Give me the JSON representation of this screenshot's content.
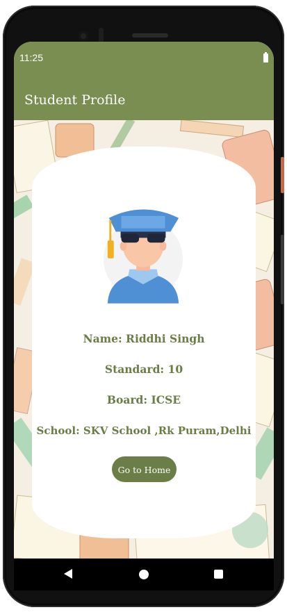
{
  "status_bar": {
    "time": "11:25"
  },
  "app_bar": {
    "title": "Student Profile"
  },
  "profile": {
    "name": "Name: Riddhi Singh",
    "standard": "Standard: 10",
    "board": "Board: ICSE",
    "school": "School: SKV School ,Rk Puram,Delhi"
  },
  "actions": {
    "home_label": "Go to Home"
  },
  "colors": {
    "primary": "#7b8e51",
    "accent_text": "#6a7d45",
    "button": "#6b7e47"
  },
  "icons": [
    "battery-icon",
    "student-avatar-icon",
    "back-icon",
    "home-icon",
    "recents-icon"
  ]
}
